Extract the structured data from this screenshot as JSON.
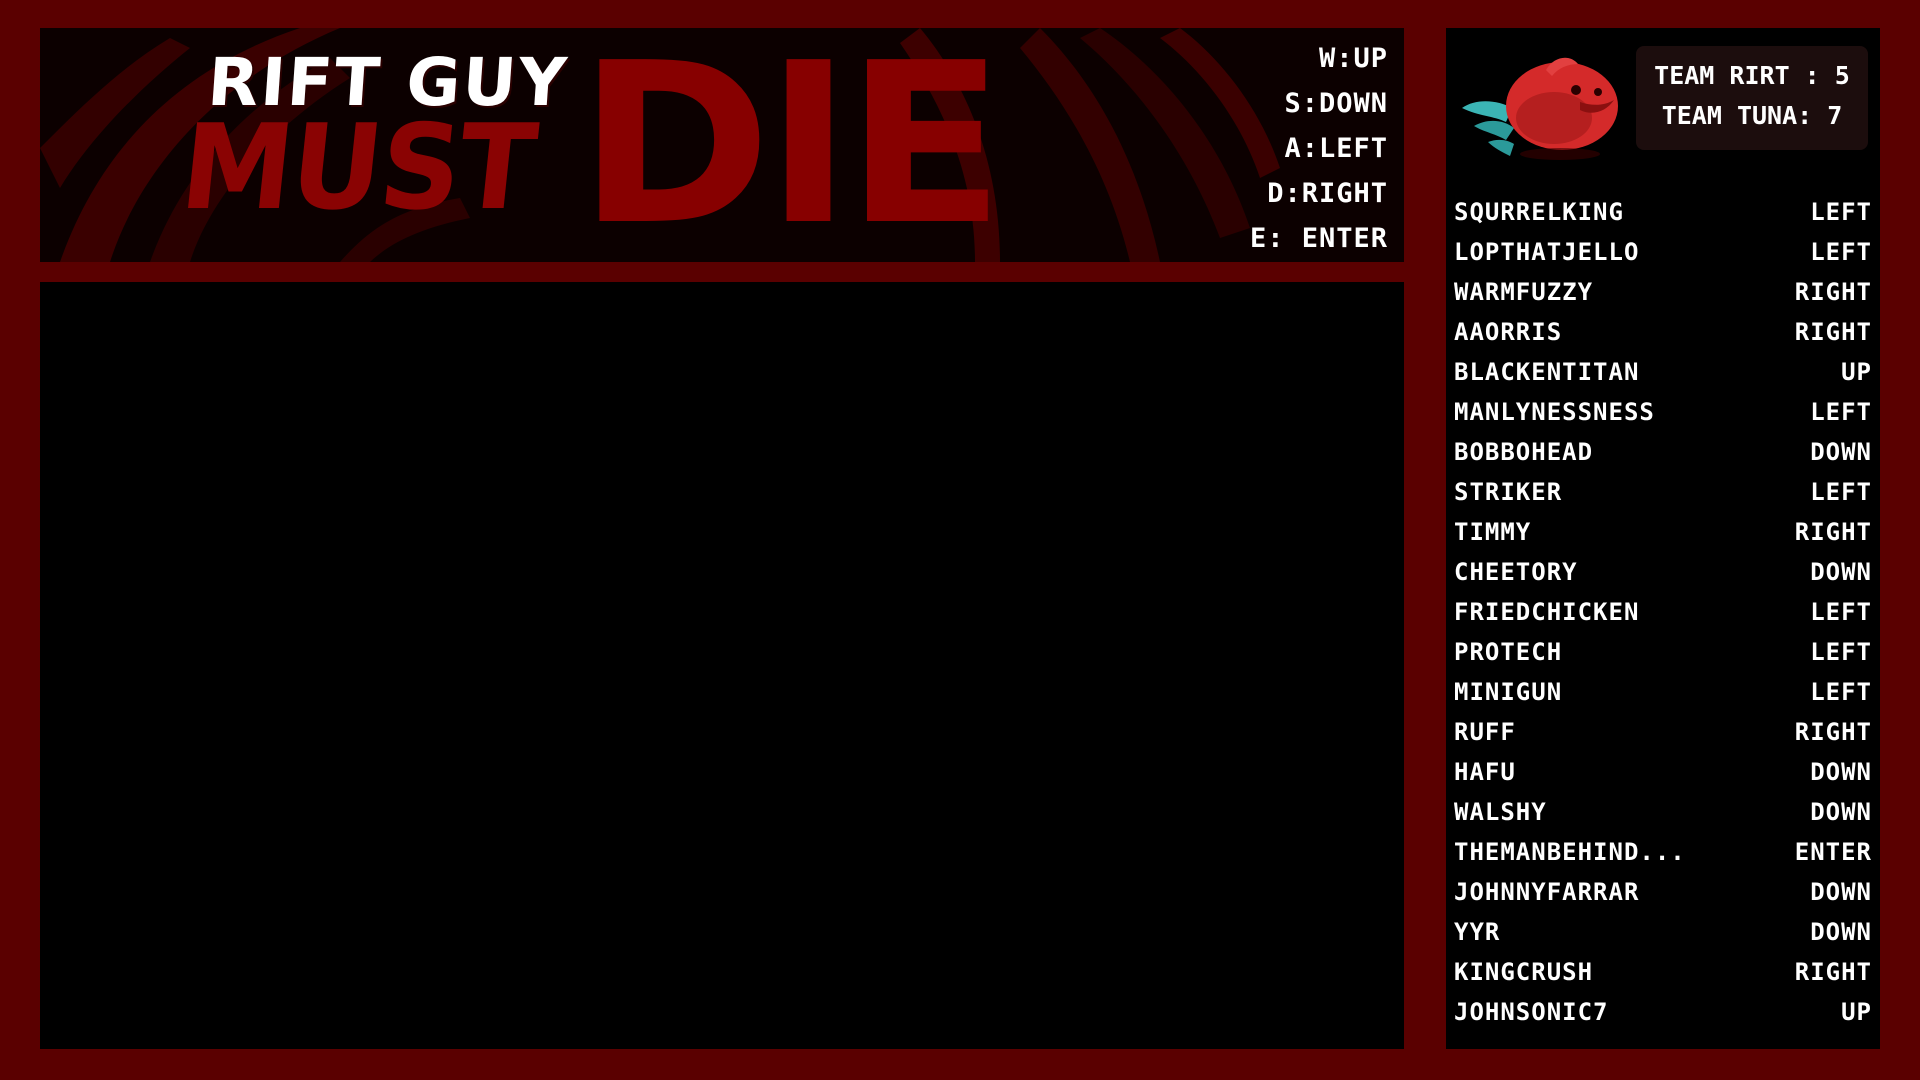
{
  "banner": {
    "title_line1": "RIFT GUY",
    "title_must": "MUST",
    "title_die": "DIE"
  },
  "controls": [
    {
      "label": "W:UP"
    },
    {
      "label": "S:DOWN"
    },
    {
      "label": "A:LEFT"
    },
    {
      "label": "D:RIGHT"
    },
    {
      "label": "E: ENTER"
    }
  ],
  "scores": {
    "team_rirt": "TEAM RIRT : 5",
    "team_tuna": "TEAM TUNA: 7"
  },
  "mascot_icon": "red-bird-icon",
  "colors": {
    "frame": "#5a0000",
    "blood_red": "#870000",
    "text": "#ffffff",
    "bird_red": "#d42a2a",
    "bird_teal": "#3bb5b5"
  },
  "players": [
    {
      "name": "SQURRELKING",
      "command": "LEFT"
    },
    {
      "name": "LOPTHATJELLO",
      "command": "LEFT"
    },
    {
      "name": "WARMFUZZY",
      "command": "RIGHT"
    },
    {
      "name": "AAORRIS",
      "command": "RIGHT"
    },
    {
      "name": "BLACKENTITAN",
      "command": "UP"
    },
    {
      "name": "MANLYNESSNESS",
      "command": "LEFT"
    },
    {
      "name": "BOBBOHEAD",
      "command": "DOWN"
    },
    {
      "name": "STRIKER",
      "command": "LEFT"
    },
    {
      "name": "TIMMY",
      "command": "RIGHT"
    },
    {
      "name": "CHEETORY",
      "command": "DOWN"
    },
    {
      "name": "FRIEDCHICKEN",
      "command": "LEFT"
    },
    {
      "name": "PROTECH",
      "command": "LEFT"
    },
    {
      "name": "MINIGUN",
      "command": "LEFT"
    },
    {
      "name": "RUFF",
      "command": "RIGHT"
    },
    {
      "name": "HAFU",
      "command": "DOWN"
    },
    {
      "name": "WALSHY",
      "command": "DOWN"
    },
    {
      "name": "THEMANBEHIND...",
      "command": "ENTER"
    },
    {
      "name": "JOHNNYFARRAR",
      "command": "DOWN"
    },
    {
      "name": "YYR",
      "command": "DOWN"
    },
    {
      "name": "KINGCRUSH",
      "command": "RIGHT"
    },
    {
      "name": "JOHNSONIC7",
      "command": "UP"
    }
  ]
}
